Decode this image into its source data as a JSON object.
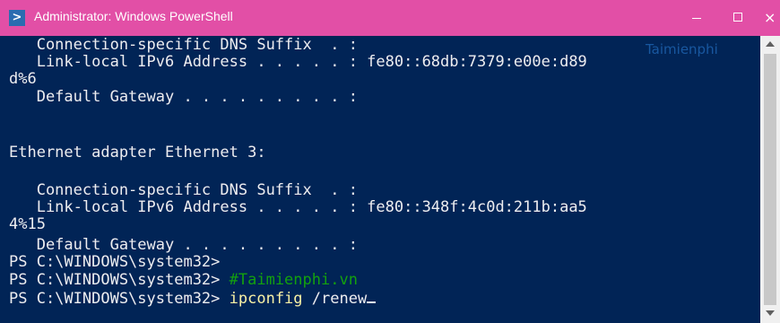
{
  "window": {
    "title": "Administrator: Windows PowerShell",
    "icon": "powershell-icon",
    "titlebar_color": "#e24fa6",
    "background_color": "#012456",
    "controls": {
      "minimize": "minimize-icon",
      "maximize": "maximize-icon",
      "close": "×"
    }
  },
  "watermark": "Taimienphi",
  "console": {
    "lines": [
      "   Connection-specific DNS Suffix  . :",
      "   Link-local IPv6 Address . . . . . : fe80::68db:7379:e00e:d89",
      "d%6",
      "   Default Gateway . . . . . . . . . :",
      "",
      "Ethernet adapter Ethernet 3:",
      "",
      "   Connection-specific DNS Suffix  . :",
      "   Link-local IPv6 Address . . . . . : fe80::348f:4c0d:211b:aa5",
      "4%15",
      "   Default Gateway . . . . . . . . . :",
      "PS C:\\WINDOWS\\system32>",
      "PS C:\\WINDOWS\\system32> "
    ],
    "comment": "#Taimienphi.vn",
    "prompt": "PS C:\\WINDOWS\\system32> ",
    "command": "ipconfig",
    "args": " /renew"
  }
}
